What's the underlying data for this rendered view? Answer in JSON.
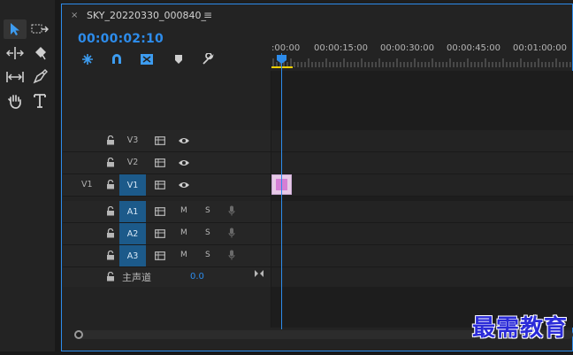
{
  "sequence": {
    "close_glyph": "×",
    "title": "SKY_20220330_000840_",
    "menu_glyph": "≡",
    "timecode": "00:00:02:10"
  },
  "ruler": {
    "labels": [
      ":00:00",
      "00:00:15:00",
      "00:00:30:00",
      "00:00:45:00",
      "00:01:00:00"
    ]
  },
  "tracks": {
    "video": [
      {
        "name": "V3",
        "source": "",
        "targeted": false
      },
      {
        "name": "V2",
        "source": "",
        "targeted": false
      },
      {
        "name": "V1",
        "source": "V1",
        "targeted": true
      }
    ],
    "audio": [
      {
        "name": "A1",
        "mute": "M",
        "solo": "S",
        "targeted": true
      },
      {
        "name": "A2",
        "mute": "M",
        "solo": "S",
        "targeted": true
      },
      {
        "name": "A3",
        "mute": "M",
        "solo": "S",
        "targeted": true
      }
    ],
    "master": {
      "label": "主声道",
      "value": "0.0"
    }
  },
  "watermark": "最需教育",
  "colors": {
    "accent": "#2d8ceb",
    "clip_fill": "#d57fd5",
    "playhead_marker": "#f0d000"
  }
}
